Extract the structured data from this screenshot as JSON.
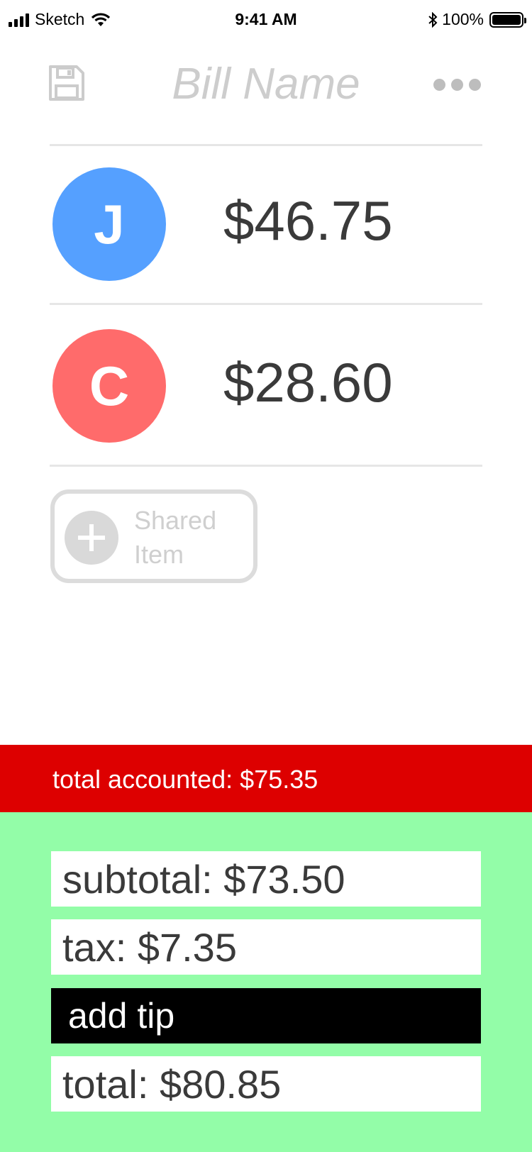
{
  "status_bar": {
    "carrier": "Sketch",
    "time": "9:41 AM",
    "battery": "100%"
  },
  "header": {
    "title_placeholder": "Bill Name",
    "save_icon": "save-icon",
    "more_icon": "more-icon"
  },
  "people": [
    {
      "initial": "J",
      "amount": "$46.75",
      "color": "#55a0ff"
    },
    {
      "initial": "C",
      "amount": "$28.60",
      "color": "#ff6b6b"
    }
  ],
  "shared_item": {
    "label": "Shared Item",
    "icon": "plus-circle-icon"
  },
  "totals": {
    "accounted": "total accounted: $75.35",
    "accounted_color": "#dd0000",
    "subtotal": "subtotal: $73.50",
    "tax": "tax: $7.35",
    "add_tip": "add tip",
    "total": "total: $80.85",
    "panel_color": "#93fda8"
  }
}
